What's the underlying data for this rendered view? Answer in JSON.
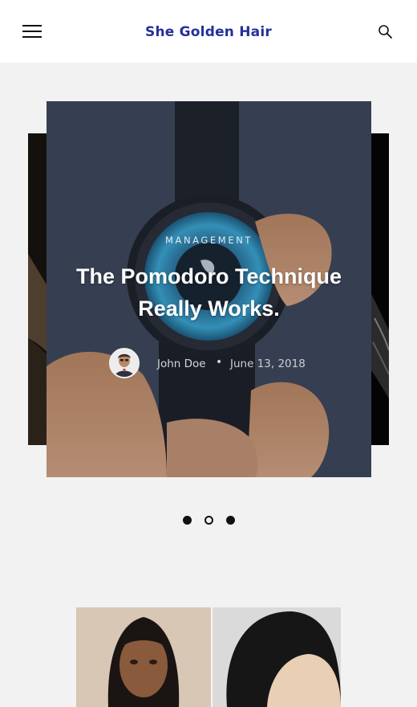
{
  "header": {
    "site_title": "She Golden Hair",
    "menu_icon": "hamburger-menu-icon",
    "search_icon": "search-icon"
  },
  "slider": {
    "active_post": {
      "category": "MANAGEMENT",
      "title_line1": "The Pomodoro Technique",
      "title_line2": "Really Works.",
      "author": "John Doe",
      "separator": "•",
      "date": "June 13, 2018"
    },
    "pagination": {
      "total": 3,
      "active_index": 1
    }
  },
  "colors": {
    "site_title": "#25309a",
    "page_background": "#f2f2f2",
    "header_background": "#ffffff"
  }
}
